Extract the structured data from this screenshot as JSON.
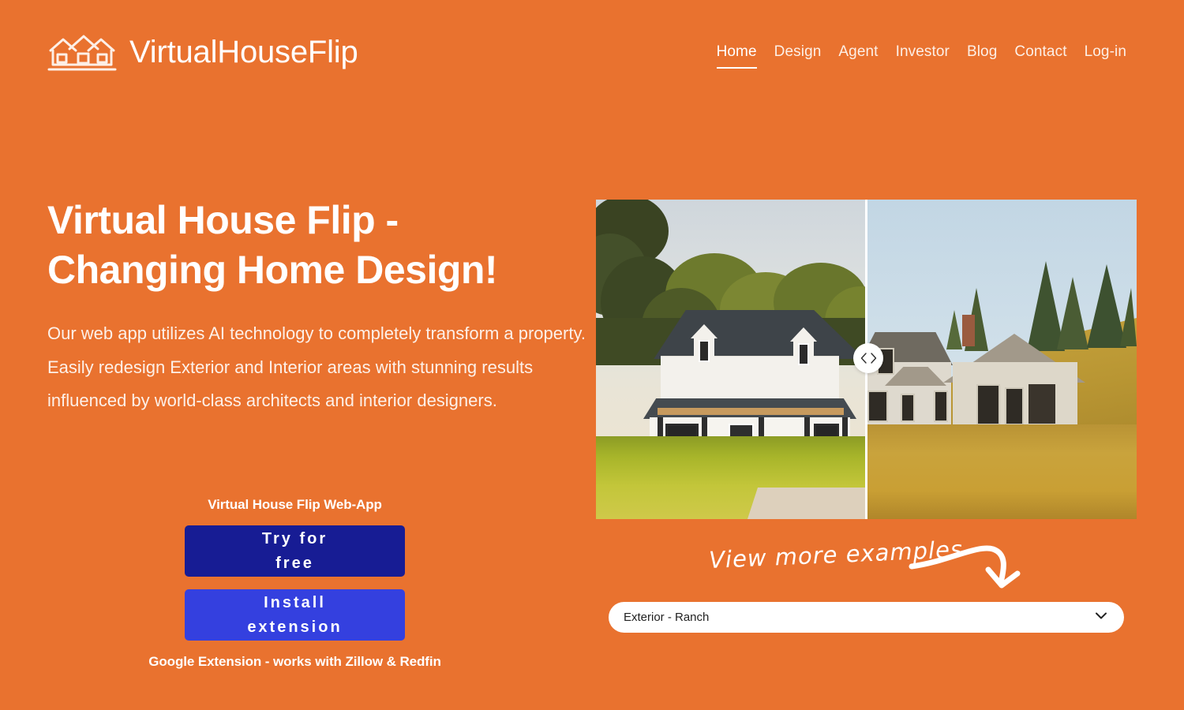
{
  "theme": {
    "background": "#E9722F",
    "text_on_orange": "#FFFFFF",
    "btn_primary_bg": "#171C94",
    "btn_secondary_bg": "#3440DF"
  },
  "header": {
    "logo_icon": "house-outline-icon",
    "brand": "VirtualHouseFlip",
    "nav": [
      {
        "label": "Home",
        "active": true
      },
      {
        "label": "Design",
        "active": false
      },
      {
        "label": "Agent",
        "active": false
      },
      {
        "label": "Investor",
        "active": false
      },
      {
        "label": "Blog",
        "active": false
      },
      {
        "label": "Contact",
        "active": false
      },
      {
        "label": "Log-in",
        "active": false
      }
    ]
  },
  "hero": {
    "headline_line1": "Virtual House Flip -",
    "headline_line2": "Changing Home Design!",
    "paragraph": "Our web app utilizes AI technology to completely transform a property. Easily redesign Exterior and Interior areas with stunning results influenced by world-class architects and interior designers."
  },
  "cta": {
    "label_above": "Virtual House Flip Web-App",
    "primary_line1": "Try for",
    "primary_line2": "free",
    "secondary_line1": "Install",
    "secondary_line2": "extension",
    "label_below": "Google Extension - works with Zillow & Redfin"
  },
  "compare": {
    "after_alt": "Renovated modern white farmhouse with dark shingle roof, dormer windows, covered porch and green lawn",
    "before_alt": "Old weathered white farmhouse with brick chimney, worn siding and golden grass field",
    "handle_icon_left": "chevron-left-icon",
    "handle_icon_right": "chevron-right-icon"
  },
  "examples": {
    "annotation": "View more examples",
    "arrow_icon": "curved-arrow-down-right-icon",
    "selected_option": "Exterior - Ranch",
    "options": [
      "Exterior - Ranch"
    ],
    "chevron_icon": "chevron-down-icon"
  }
}
